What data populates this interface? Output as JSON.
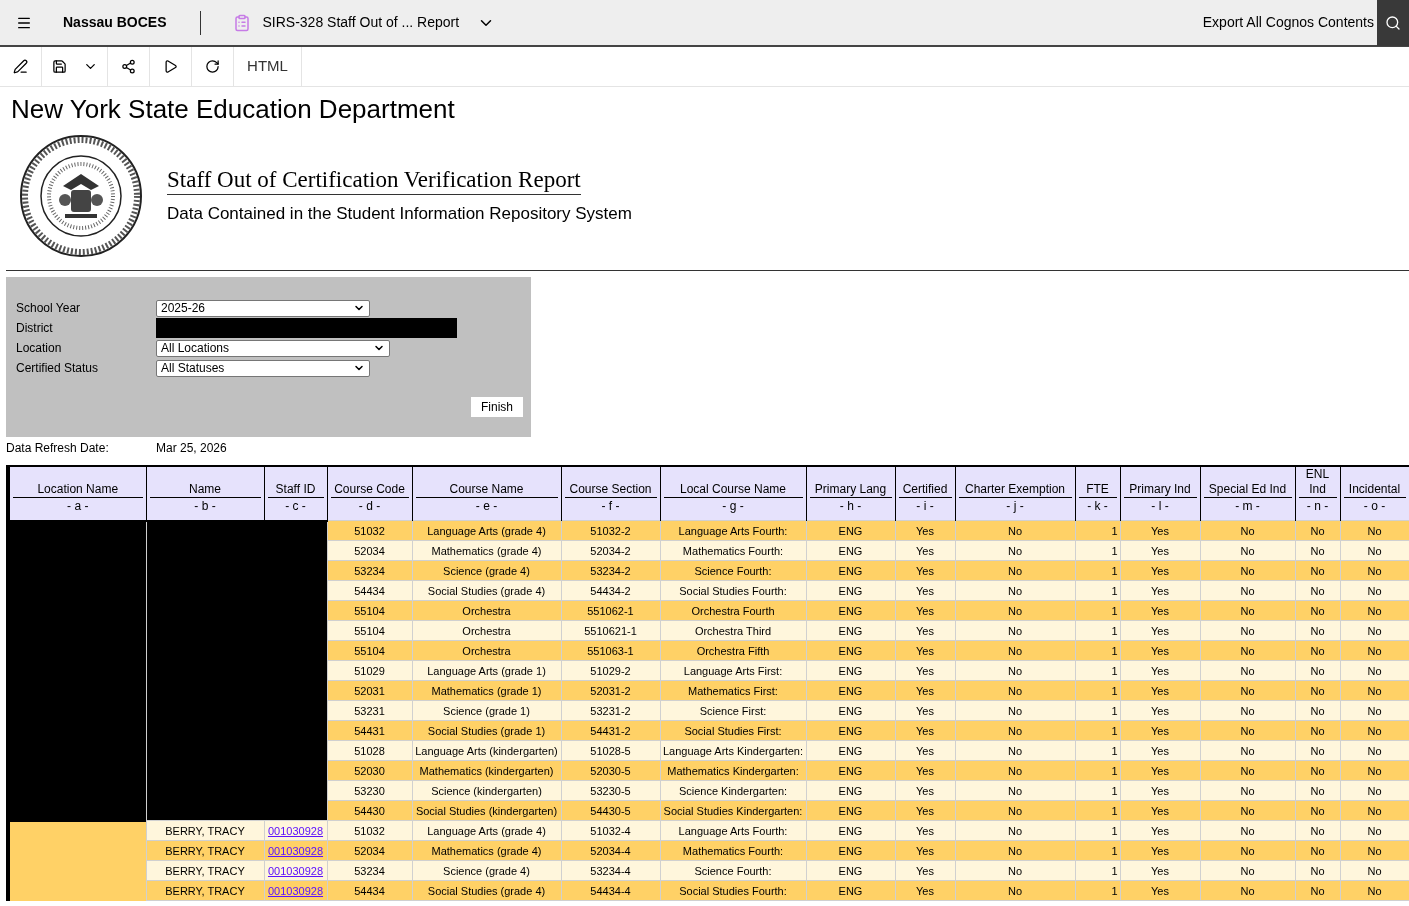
{
  "app_bar": {
    "org": "Nassau BOCES",
    "report_title": "SIRS-328 Staff Out of ... Report",
    "export_link": "Export All Cognos Contents"
  },
  "toolbar": {
    "format": "HTML"
  },
  "header": {
    "agency": "New York State Education Department",
    "report_name": "Staff Out of Certification Verification Report",
    "subtitle": "Data Contained in the Student Information Repository System"
  },
  "filters": [
    {
      "label": "School Year",
      "kind": "select",
      "value": "2025-26"
    },
    {
      "label": "District",
      "kind": "redacted"
    },
    {
      "label": "Location",
      "kind": "select",
      "value": "All Locations"
    },
    {
      "label": "Certified Status",
      "kind": "select",
      "value": "All Statuses"
    }
  ],
  "finish_button": "Finish",
  "refresh": {
    "label": "Data Refresh Date:",
    "value": "Mar 25, 2026"
  },
  "table": {
    "columns": [
      {
        "title": "Location Name",
        "letter": "- a -"
      },
      {
        "title": "Name",
        "letter": "- b -"
      },
      {
        "title": "Staff ID",
        "letter": "- c -"
      },
      {
        "title": "Course Code",
        "letter": "- d -"
      },
      {
        "title": "Course Name",
        "letter": "- e -"
      },
      {
        "title": "Course Section",
        "letter": "- f -"
      },
      {
        "title": "Local Course Name",
        "letter": "- g -"
      },
      {
        "title": "Primary Lang",
        "letter": "- h -"
      },
      {
        "title": "Certified",
        "letter": "- i -"
      },
      {
        "title": "Charter Exemption",
        "letter": "- j -"
      },
      {
        "title": "FTE",
        "letter": "- k -"
      },
      {
        "title": "Primary Ind",
        "letter": "- l -"
      },
      {
        "title": "Special Ed Ind",
        "letter": "- m -"
      },
      {
        "title": "ENL Ind",
        "letter": "- n -"
      },
      {
        "title": "Incidental",
        "letter": "- o -"
      }
    ],
    "rows": [
      {
        "redacted": true,
        "cells": [
          "",
          "",
          "",
          "51032",
          "Language Arts (grade 4)",
          "51032-2",
          "Language Arts Fourth:",
          "ENG",
          "Yes",
          "No",
          "1",
          "Yes",
          "No",
          "No",
          "No"
        ]
      },
      {
        "redacted": true,
        "cells": [
          "",
          "",
          "",
          "52034",
          "Mathematics (grade 4)",
          "52034-2",
          "Mathematics Fourth:",
          "ENG",
          "Yes",
          "No",
          "1",
          "Yes",
          "No",
          "No",
          "No"
        ]
      },
      {
        "redacted": true,
        "cells": [
          "",
          "",
          "",
          "53234",
          "Science (grade 4)",
          "53234-2",
          "Science Fourth:",
          "ENG",
          "Yes",
          "No",
          "1",
          "Yes",
          "No",
          "No",
          "No"
        ]
      },
      {
        "redacted": true,
        "cells": [
          "",
          "",
          "",
          "54434",
          "Social Studies (grade 4)",
          "54434-2",
          "Social Studies Fourth:",
          "ENG",
          "Yes",
          "No",
          "1",
          "Yes",
          "No",
          "No",
          "No"
        ]
      },
      {
        "redacted": true,
        "cells": [
          "",
          "",
          "",
          "55104",
          "Orchestra",
          "551062-1",
          "Orchestra Fourth",
          "ENG",
          "Yes",
          "No",
          "1",
          "Yes",
          "No",
          "No",
          "No"
        ]
      },
      {
        "redacted": true,
        "cells": [
          "",
          "",
          "",
          "55104",
          "Orchestra",
          "5510621-1",
          "Orchestra Third",
          "ENG",
          "Yes",
          "No",
          "1",
          "Yes",
          "No",
          "No",
          "No"
        ]
      },
      {
        "redacted": true,
        "cells": [
          "",
          "",
          "",
          "55104",
          "Orchestra",
          "551063-1",
          "Orchestra Fifth",
          "ENG",
          "Yes",
          "No",
          "1",
          "Yes",
          "No",
          "No",
          "No"
        ]
      },
      {
        "redacted": true,
        "cells": [
          "",
          "",
          "",
          "51029",
          "Language Arts (grade 1)",
          "51029-2",
          "Language Arts First:",
          "ENG",
          "Yes",
          "No",
          "1",
          "Yes",
          "No",
          "No",
          "No"
        ]
      },
      {
        "redacted": true,
        "cells": [
          "",
          "",
          "",
          "52031",
          "Mathematics (grade 1)",
          "52031-2",
          "Mathematics First:",
          "ENG",
          "Yes",
          "No",
          "1",
          "Yes",
          "No",
          "No",
          "No"
        ]
      },
      {
        "redacted": true,
        "cells": [
          "",
          "",
          "",
          "53231",
          "Science (grade 1)",
          "53231-2",
          "Science First:",
          "ENG",
          "Yes",
          "No",
          "1",
          "Yes",
          "No",
          "No",
          "No"
        ]
      },
      {
        "redacted": true,
        "cells": [
          "",
          "",
          "",
          "54431",
          "Social Studies (grade 1)",
          "54431-2",
          "Social Studies First:",
          "ENG",
          "Yes",
          "No",
          "1",
          "Yes",
          "No",
          "No",
          "No"
        ]
      },
      {
        "redacted": true,
        "cells": [
          "",
          "",
          "",
          "51028",
          "Language Arts (kindergarten)",
          "51028-5",
          "Language Arts Kindergarten:",
          "ENG",
          "Yes",
          "No",
          "1",
          "Yes",
          "No",
          "No",
          "No"
        ]
      },
      {
        "redacted": true,
        "cells": [
          "",
          "",
          "",
          "52030",
          "Mathematics (kindergarten)",
          "52030-5",
          "Mathematics Kindergarten:",
          "ENG",
          "Yes",
          "No",
          "1",
          "Yes",
          "No",
          "No",
          "No"
        ]
      },
      {
        "redacted": true,
        "cells": [
          "",
          "",
          "",
          "53230",
          "Science (kindergarten)",
          "53230-5",
          "Science Kindergarten:",
          "ENG",
          "Yes",
          "No",
          "1",
          "Yes",
          "No",
          "No",
          "No"
        ]
      },
      {
        "redacted": true,
        "cells": [
          "",
          "",
          "",
          "54430",
          "Social Studies (kindergarten)",
          "54430-5",
          "Social Studies Kindergarten:",
          "ENG",
          "Yes",
          "No",
          "1",
          "Yes",
          "No",
          "No",
          "No"
        ]
      },
      {
        "redacted": false,
        "cells": [
          "",
          "BERRY, TRACY",
          "001030928",
          "51032",
          "Language Arts (grade 4)",
          "51032-4",
          "Language Arts Fourth:",
          "ENG",
          "Yes",
          "No",
          "1",
          "Yes",
          "No",
          "No",
          "No"
        ]
      },
      {
        "redacted": false,
        "cells": [
          "",
          "BERRY, TRACY",
          "001030928",
          "52034",
          "Mathematics (grade 4)",
          "52034-4",
          "Mathematics Fourth:",
          "ENG",
          "Yes",
          "No",
          "1",
          "Yes",
          "No",
          "No",
          "No"
        ]
      },
      {
        "redacted": false,
        "cells": [
          "",
          "BERRY, TRACY",
          "001030928",
          "53234",
          "Science (grade 4)",
          "53234-4",
          "Science Fourth:",
          "ENG",
          "Yes",
          "No",
          "1",
          "Yes",
          "No",
          "No",
          "No"
        ]
      },
      {
        "redacted": false,
        "cells": [
          "",
          "BERRY, TRACY",
          "001030928",
          "54434",
          "Social Studies (grade 4)",
          "54434-4",
          "Social Studies Fourth:",
          "ENG",
          "Yes",
          "No",
          "1",
          "Yes",
          "No",
          "No",
          "No"
        ]
      }
    ]
  }
}
